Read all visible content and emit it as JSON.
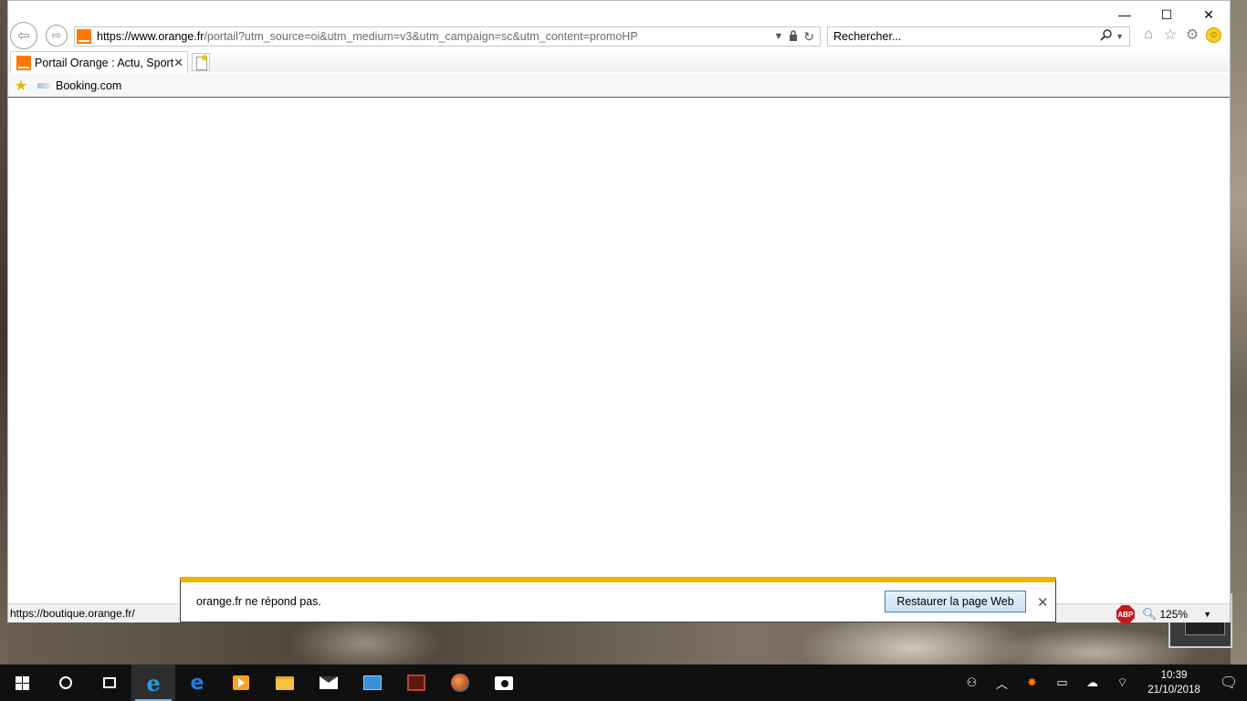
{
  "window": {
    "minimize": "—",
    "maximize": "☐",
    "close": "✕"
  },
  "address": {
    "url_host": "https://www.orange.fr",
    "url_rest": "/portail?utm_source=oi&utm_medium=v3&utm_campaign=sc&utm_content=promoHP"
  },
  "search": {
    "placeholder": "Rechercher..."
  },
  "tab": {
    "title": "Portail Orange : Actu, Sport...",
    "close": "✕"
  },
  "favorites": {
    "items": [
      {
        "label": "Booking.com"
      }
    ]
  },
  "status": {
    "url": "https://boutique.orange.fr/",
    "abp": "ABP",
    "zoom": "125%"
  },
  "notification": {
    "message": "orange.fr ne répond pas.",
    "button": "Restaurer la page Web",
    "close": "✕"
  },
  "taskbar": {
    "time": "10:39",
    "date": "21/10/2018"
  },
  "colors": {
    "orange_brand": "#ff7900",
    "notif_accent": "#f0b400",
    "taskbar": "#101010"
  }
}
